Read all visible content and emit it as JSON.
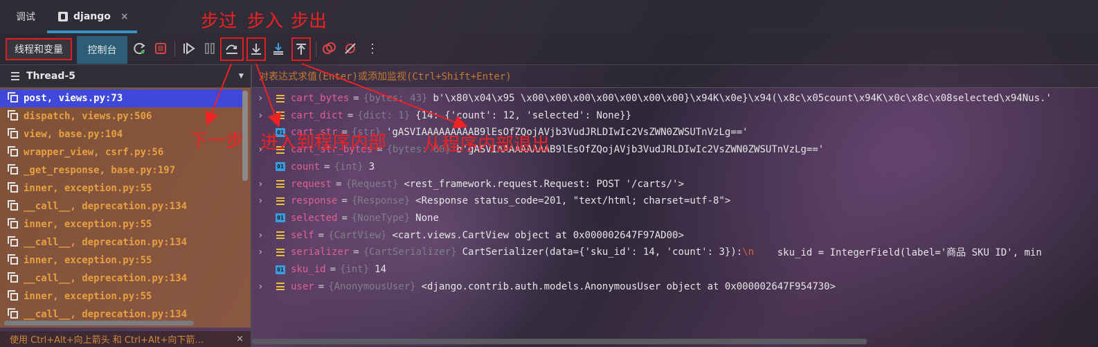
{
  "tabs": {
    "debug_label": "调试",
    "active_label": "django",
    "close_glyph": "×"
  },
  "toolbar": {
    "threads_vars_label": "线程和变量",
    "console_label": "控制台",
    "more_glyph": "⋮"
  },
  "thread_selector": {
    "label": "Thread-5"
  },
  "frames": [
    "post, views.py:73",
    "dispatch, views.py:506",
    "view, base.py:104",
    "wrapper_view, csrf.py:56",
    "_get_response, base.py:197",
    "inner, exception.py:55",
    "__call__, deprecation.py:134",
    "inner, exception.py:55",
    "__call__, deprecation.py:134",
    "inner, exception.py:55",
    "__call__, deprecation.py:134",
    "inner, exception.py:55",
    "__call__, deprecation.py:134"
  ],
  "hint": {
    "text": "使用 Ctrl+Alt+向上箭头 和 Ctrl+Alt+向下箭…",
    "close_glyph": "×"
  },
  "eval_placeholder": "对表达式求值(Enter)或添加监视(Ctrl+Shift+Enter)",
  "variables": [
    {
      "name": "cart_bytes",
      "type": "{bytes: 43}",
      "value": "b'\\x80\\x04\\x95 \\x00\\x00\\x00\\x00\\x00\\x00\\x00}\\x94K\\x0e}\\x94(\\x8c\\x05count\\x94K\\x0c\\x8c\\x08selected\\x94Nus.'",
      "icon": "object",
      "expandable": true
    },
    {
      "name": "cart_dict",
      "type": "{dict: 1}",
      "value": "{14: {'count': 12, 'selected': None}}",
      "icon": "object",
      "expandable": true
    },
    {
      "name": "cart_str",
      "type": "{str}",
      "value": "'gASVIAAAAAAAAAB9lEsOfZQojAVjb3VudJRLDIwIc2VsZWN0ZWSUTnVzLg=='",
      "icon": "number",
      "expandable": false
    },
    {
      "name": "cart_str_bytes",
      "type": "{bytes: 60}",
      "value": "b'gASVIAAAAAAAAAB9lEsOfZQojAVjb3VudJRLDIwIc2VsZWN0ZWSUTnVzLg=='",
      "icon": "object",
      "expandable": true
    },
    {
      "name": "count",
      "type": "{int}",
      "value": "3",
      "icon": "number",
      "expandable": false
    },
    {
      "name": "request",
      "type": "{Request}",
      "value": "<rest_framework.request.Request: POST '/carts/'>",
      "icon": "object",
      "expandable": true
    },
    {
      "name": "response",
      "type": "{Response}",
      "value": "<Response status_code=201, \"text/html; charset=utf-8\">",
      "icon": "object",
      "expandable": true
    },
    {
      "name": "selected",
      "type": "{NoneType}",
      "value": "None",
      "icon": "number",
      "expandable": false
    },
    {
      "name": "self",
      "type": "{CartView}",
      "value": "<cart.views.CartView object at 0x000002647F97AD00>",
      "icon": "object",
      "expandable": true
    },
    {
      "name": "serializer",
      "type": "{CartSerializer}",
      "value": "CartSerializer(data={'sku_id': 14, 'count': 3}):",
      "value_suffix": "\\n",
      "value_tail": "    sku_id = IntegerField(label='商品 SKU ID', min",
      "icon": "object",
      "expandable": true
    },
    {
      "name": "sku_id",
      "type": "{int}",
      "value": "14",
      "icon": "number",
      "expandable": false
    },
    {
      "name": "user",
      "type": "{AnonymousUser}",
      "value": "<django.contrib.auth.models.AnonymousUser object at 0x000002647F954730>",
      "icon": "object",
      "expandable": true
    }
  ],
  "annotations": {
    "step_over": "步过",
    "step_into": "步入",
    "step_out": "步出",
    "next_step": "下一步",
    "enter_program": "进入到程序内部",
    "exit_program": "从程序内部退出"
  },
  "colors": {
    "annotation": "#ee2222",
    "selected_frame": "#3f48d8",
    "frame_text": "#e8a040",
    "var_name": "#e06090"
  }
}
